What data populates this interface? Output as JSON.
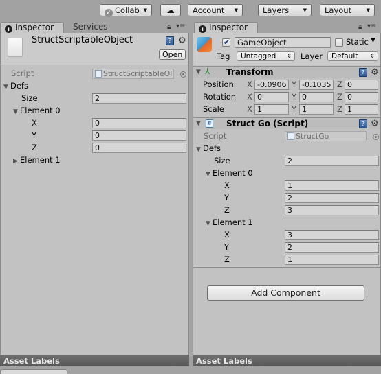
{
  "toolbar": {
    "collab": "Collab",
    "account": "Account",
    "layers": "Layers",
    "layout": "Layout"
  },
  "left": {
    "tabs": [
      {
        "label": "Inspector"
      },
      {
        "label": "Services"
      }
    ],
    "object_name": "StructScriptableObject",
    "open_label": "Open",
    "script_label": "Script",
    "script_value": "StructScriptableOl",
    "defs_label": "Defs",
    "size_label": "Size",
    "size_value": "2",
    "elements": [
      {
        "label": "Element 0",
        "expanded": true,
        "x_label": "X",
        "x": "0",
        "y_label": "Y",
        "y": "0",
        "z_label": "Z",
        "z": "0"
      },
      {
        "label": "Element 1",
        "expanded": false
      }
    ],
    "asset_labels": "Asset Labels"
  },
  "right": {
    "tab": "Inspector",
    "object_name": "GameObject",
    "active": true,
    "static_label": "Static",
    "static_checked": false,
    "tag_label": "Tag",
    "tag_value": "Untagged",
    "layer_label": "Layer",
    "layer_value": "Default",
    "transform": {
      "title": "Transform",
      "position_label": "Position",
      "rotation_label": "Rotation",
      "scale_label": "Scale",
      "axis": {
        "x": "X",
        "y": "Y",
        "z": "Z"
      },
      "position": {
        "x": "-0.0906",
        "y": "-0.1035",
        "z": "0"
      },
      "rotation": {
        "x": "0",
        "y": "0",
        "z": "0"
      },
      "scale": {
        "x": "1",
        "y": "1",
        "z": "1"
      }
    },
    "script_component": {
      "title": "Struct Go (Script)",
      "script_label": "Script",
      "script_value": "StructGo",
      "defs_label": "Defs",
      "size_label": "Size",
      "size_value": "2",
      "elements": [
        {
          "label": "Element 0",
          "x_label": "X",
          "x": "1",
          "y_label": "Y",
          "y": "2",
          "z_label": "Z",
          "z": "3"
        },
        {
          "label": "Element 1",
          "x_label": "X",
          "x": "3",
          "y_label": "Y",
          "y": "2",
          "z_label": "Z",
          "z": "1"
        }
      ]
    },
    "add_component": "Add Component",
    "asset_labels": "Asset Labels"
  }
}
